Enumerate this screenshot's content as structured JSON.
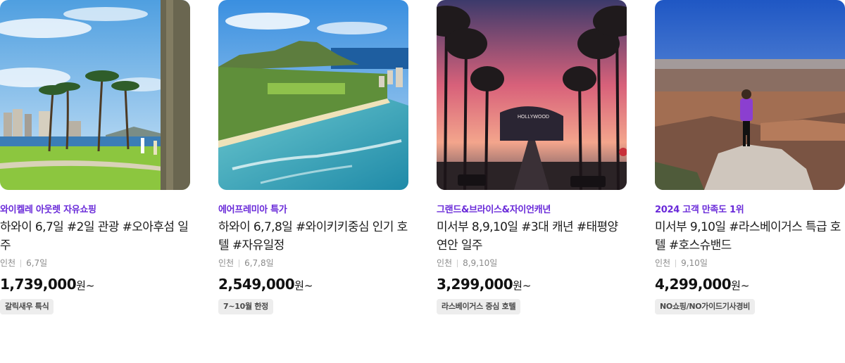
{
  "cards": [
    {
      "image_alt": "hawaii-park-palms",
      "tagline": "와이켈레 아웃렛 자유쇼핑",
      "title": "하와이 6,7일 #2일 관광 #오아후섬 일주",
      "origin": "인천",
      "duration": "6,7일",
      "price": "1,739,000",
      "price_unit": "원~",
      "badge": "갈릭새우 특식"
    },
    {
      "image_alt": "diamond-head-coast",
      "tagline": "에어프레미아 특가",
      "title": "하와이 6,7,8일 #와이키키중심 인기 호텔 #자유일정",
      "origin": "인천",
      "duration": "6,7,8일",
      "price": "2,549,000",
      "price_unit": "원~",
      "badge": "7~10월 한정"
    },
    {
      "image_alt": "hollywood-palm-street",
      "tagline": "그랜드&브라이스&자이언캐년",
      "title": "미서부 8,9,10일 #3대 캐년 #태평양 연안 일주",
      "origin": "인천",
      "duration": "8,9,10일",
      "price": "3,299,000",
      "price_unit": "원~",
      "badge": "라스베이거스 중심 호텔"
    },
    {
      "image_alt": "grand-canyon-overlook",
      "tagline": "2024 고객 만족도 1위",
      "title": "미서부 9,10일 #라스베이거스 특급 호텔 #호스슈밴드",
      "origin": "인천",
      "duration": "9,10일",
      "price": "4,299,000",
      "price_unit": "원~",
      "badge": "NO쇼핑/NO가이드기사경비"
    }
  ]
}
